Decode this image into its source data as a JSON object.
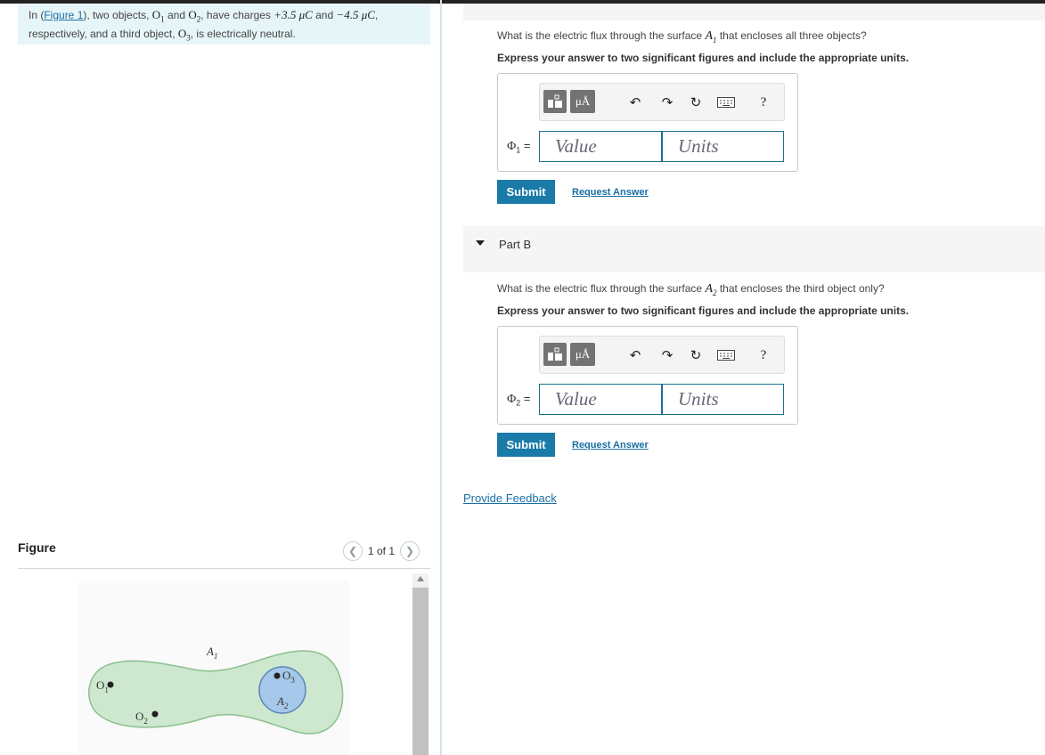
{
  "intro": {
    "p1": "In (",
    "figure_link": "Figure 1",
    "p2": "), two objects, ",
    "o1": "O",
    "o1_sub": "1",
    "p3": " and ",
    "o2": "O",
    "o2_sub": "2",
    "p4": ", have charges ",
    "q1": "+3.5 μC",
    "p5": " and ",
    "q2": "−4.5 μC",
    "p6": ",",
    "line2a": "respectively, and a third object, ",
    "o3": "O",
    "o3_sub": "3",
    "line2b": ", is electrically neutral."
  },
  "figure_panel": {
    "title": "Figure",
    "counter": "1 of 1",
    "prev_icon": "chevron-left-icon",
    "next_icon": "chevron-right-icon",
    "labels": {
      "o1": "O",
      "o1_sub": "1",
      "o2": "O",
      "o2_sub": "2",
      "o3": "O",
      "o3_sub": "3",
      "a1": "A",
      "a1_sub": "1",
      "a2": "A",
      "a2_sub": "2"
    },
    "colors": {
      "surface_a1": "#cde8cf",
      "surface_a2": "#a6c8ea"
    }
  },
  "part_a": {
    "question_pre": "What is the electric flux through the surface ",
    "question_var": "A",
    "question_sub": "1",
    "question_post": " that encloses all three objects?",
    "instruction": "Express your answer to two significant figures and include the appropriate units.",
    "symbol": "Φ",
    "symbol_sub": "1",
    "equals": "=",
    "value_placeholder": "Value",
    "units_placeholder": "Units",
    "submit": "Submit",
    "request_answer": "Request Answer"
  },
  "part_b": {
    "label": "Part B",
    "question_pre": "What is the electric flux through the surface ",
    "question_var": "A",
    "question_sub": "2",
    "question_post": " that encloses the third object only?",
    "instruction": "Express your answer to two significant figures and include the appropriate units.",
    "symbol": "Φ",
    "symbol_sub": "2",
    "equals": "=",
    "value_placeholder": "Value",
    "units_placeholder": "Units",
    "submit": "Submit",
    "request_answer": "Request Answer"
  },
  "toolbar": {
    "templates_icon": "templates-icon",
    "units_button": "μÅ",
    "undo_icon": "undo-icon",
    "redo_icon": "redo-icon",
    "reset_icon": "reset-icon",
    "keyboard_icon": "keyboard-icon",
    "help": "?"
  },
  "provide_feedback": "Provide Feedback",
  "colors": {
    "accent": "#1a7aa8",
    "link": "#1a6fa5",
    "intro_bg": "#e6f5f8"
  }
}
